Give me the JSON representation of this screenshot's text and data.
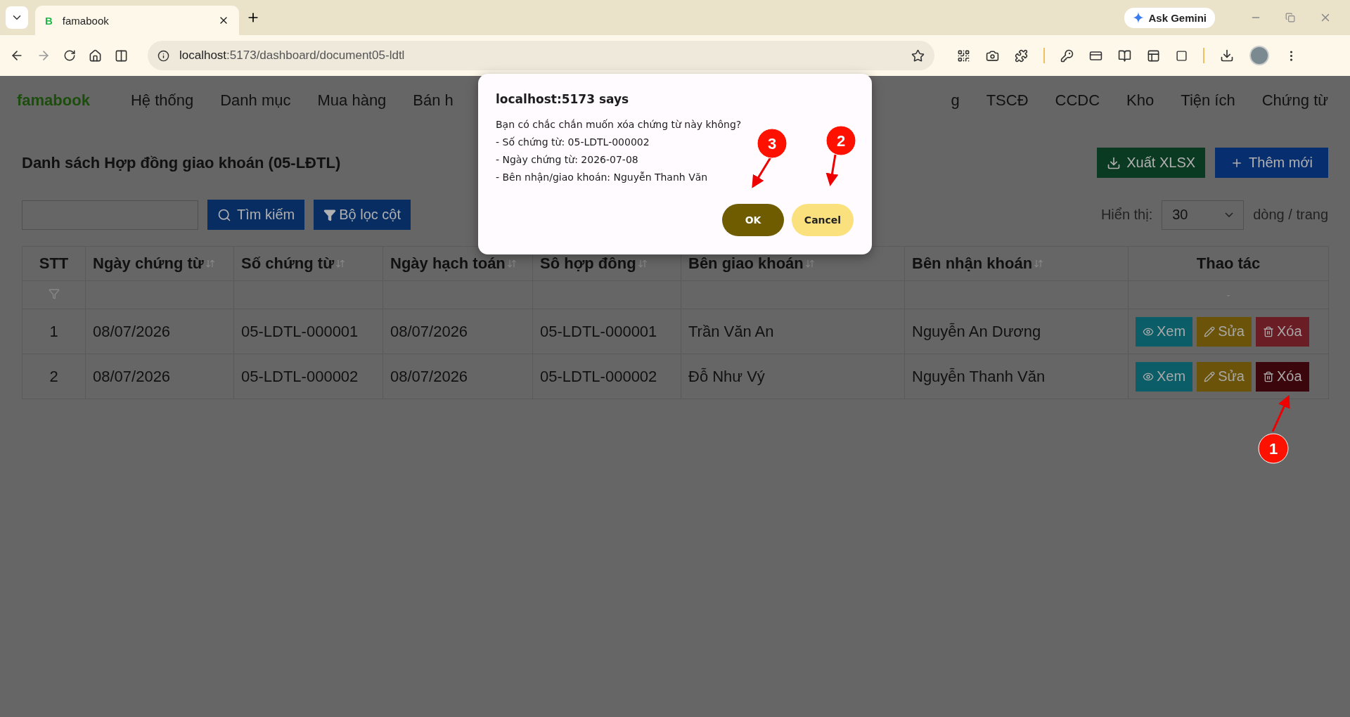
{
  "browser": {
    "tab_title": "famabook",
    "tab_favicon": "B",
    "url_host": "localhost",
    "url_rest": ":5173/dashboard/document05-ldtl",
    "gemini": "Ask Gemini"
  },
  "nav": {
    "brand": "famabook",
    "left_items": [
      "Hệ thống",
      "Danh mục",
      "Mua hàng",
      "Bán h"
    ],
    "right_items": [
      "g",
      "TSCĐ",
      "CCDC",
      "Kho",
      "Tiện ích",
      "Chứng từ"
    ]
  },
  "page": {
    "title": "Danh sách Hợp đồng giao khoán (05-LĐTL)",
    "search_button": "Tìm kiếm",
    "filter_button": "Bộ lọc cột",
    "export_button": "Xuất XLSX",
    "add_button": "Thêm mới",
    "page_size_label": "Hiển thị:",
    "page_size": "30",
    "page_size_suffix": "dòng / trang"
  },
  "table": {
    "columns": [
      {
        "label": "STT",
        "sortable": false
      },
      {
        "label": "Ngày chứng từ",
        "sortable": true
      },
      {
        "label": "Số chứng từ",
        "sortable": true
      },
      {
        "label": "Ngày hạch toán",
        "sortable": true
      },
      {
        "label": "Sô hợp đông",
        "sortable": true
      },
      {
        "label": "Bên giao khoán",
        "sortable": true
      },
      {
        "label": "Bên nhận khoán",
        "sortable": true
      },
      {
        "label": "Thao tác",
        "sortable": false
      }
    ],
    "filter_actions_text": "-",
    "rows": [
      {
        "cells": [
          "1",
          "08/07/2026",
          "05-LDTL-000001",
          "08/07/2026",
          "05-LDTL-000001",
          "Trần Văn An",
          "Nguyễn An Dương"
        ],
        "actions": [
          "Xem",
          "Sửa",
          "Xóa"
        ],
        "delete_hovered": false
      },
      {
        "cells": [
          "2",
          "08/07/2026",
          "05-LDTL-000002",
          "08/07/2026",
          "05-LDTL-000002",
          "Đỗ Như Vý",
          "Nguyễn Thanh Văn"
        ],
        "actions": [
          "Xem",
          "Sửa",
          "Xóa"
        ],
        "delete_hovered": true
      }
    ]
  },
  "dialog": {
    "title": "localhost:5173 says",
    "lines": [
      "Bạn có chắc chắn muốn xóa chứng từ này không?",
      "- Số chứng từ: 05-LDTL-000002",
      "- Ngày chứng từ: 2026-07-08",
      "- Bên nhận/giao khoán: Nguyễn Thanh Văn"
    ],
    "ok": "OK",
    "cancel": "Cancel"
  },
  "annotations": [
    {
      "label": "3"
    },
    {
      "label": "2"
    },
    {
      "label": "1"
    }
  ]
}
